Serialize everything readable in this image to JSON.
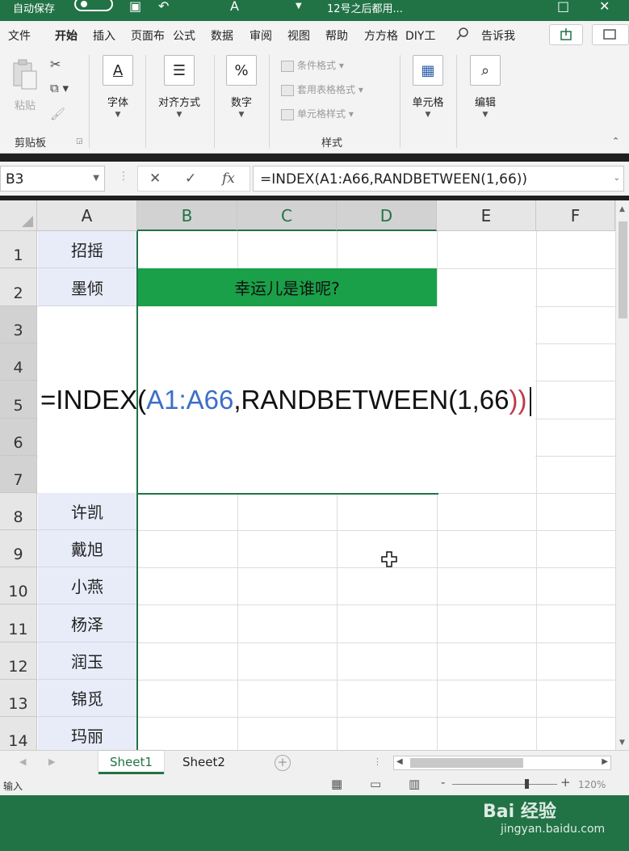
{
  "titlebar": {
    "autosave": "自动保存",
    "filename": "12号之后都用..."
  },
  "tabs": {
    "file": "文件",
    "home": "开始",
    "insert": "插入",
    "layout": "页面布",
    "formulas": "公式",
    "data": "数据",
    "review": "审阅",
    "view": "视图",
    "help": "帮助",
    "fangfang": "方方格",
    "diy": "DIY工",
    "tellme": "告诉我"
  },
  "ribbon": {
    "paste": "粘贴",
    "clipboard": "剪贴板",
    "font": "字体",
    "font_icon": "A",
    "align": "对齐方式",
    "number": "数字",
    "number_icon": "%",
    "cond_format": "条件格式",
    "table_format": "套用表格格式",
    "cell_style": "单元格样式",
    "styles": "样式",
    "cells": "单元格",
    "editing": "编辑"
  },
  "formula_bar": {
    "name_box": "B3",
    "formula": "=INDEX(A1:A66,RANDBETWEEN(1,66))"
  },
  "columns": [
    "A",
    "B",
    "C",
    "D",
    "E",
    "F"
  ],
  "rows": [
    "1",
    "2",
    "3",
    "4",
    "5",
    "6",
    "7",
    "8",
    "9",
    "10",
    "11",
    "12",
    "13",
    "14"
  ],
  "cells": {
    "A1": "招摇",
    "A2": "墨倾",
    "A8": "许凯",
    "A9": "戴旭",
    "A10": "小燕",
    "A11": "杨泽",
    "A12": "润玉",
    "A13": "锦觅",
    "A14": "玛丽",
    "B2": "幸运儿是谁呢?"
  },
  "big_formula": {
    "prefix": "=INDEX(",
    "range": "A1:A66",
    "func": ",RANDBETWEEN(",
    "args": "1,66",
    "suffix": "))"
  },
  "sheets": [
    "Sheet1",
    "Sheet2"
  ],
  "statusbar": {
    "mode": "输入",
    "zoom": "120%"
  },
  "watermark": {
    "brand": "Bai  经验",
    "url": "jingyan.baidu.com"
  },
  "colors": {
    "excel_green": "#217346",
    "highlight_green": "#1aa048",
    "name_cells": "#e8ecf9",
    "formula_blue": "#3d6fc7",
    "formula_red": "#c0394b"
  }
}
